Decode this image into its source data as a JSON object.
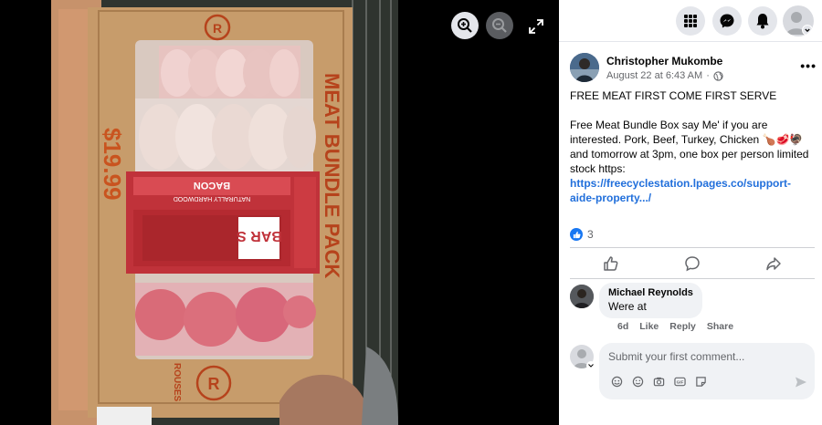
{
  "viewer": {
    "zoom_in_icon": "zoom-in-icon",
    "zoom_out_icon": "zoom-out-icon",
    "fullscreen_icon": "expand-icon",
    "photo": {
      "box_side_text": "MEAT BUNDLE PACK",
      "price_text": "$19.99",
      "brand_text": "ROUSES",
      "bacon_text": "BACON",
      "bacon_sub": "NATURALLY HARDWOOD",
      "bars_text": "BAR S"
    }
  },
  "topbar": {
    "icons": [
      "menu-grid-icon",
      "messenger-icon",
      "bell-icon",
      "account-icon"
    ]
  },
  "post": {
    "author": "Christopher Mukombe",
    "date": "August 22 at 6:43 AM",
    "separator": "·",
    "audience_icon": "globe-icon",
    "more": "•••",
    "line1": "FREE MEAT FIRST COME FIRST SERVE",
    "line2": "Free Meat Bundle Box say Me' if you are interested. Pork, Beef, Turkey, Chicken 🍗🥩🦃 and tomorrow at 3pm, one box per person limited stock https:",
    "link": "https://freecyclestation.lpages.co/support-aide-property.../",
    "reaction_count": "3"
  },
  "comment": {
    "name": "Michael Reynolds",
    "text": "Were at",
    "time": "6d",
    "like": "Like",
    "reply": "Reply",
    "share": "Share"
  },
  "composer": {
    "placeholder": "Submit your first comment..."
  },
  "colors": {
    "accent": "#1877f2",
    "link": "#216fdb",
    "panel_bg": "#ffffff",
    "bubble_bg": "#f0f2f5"
  }
}
